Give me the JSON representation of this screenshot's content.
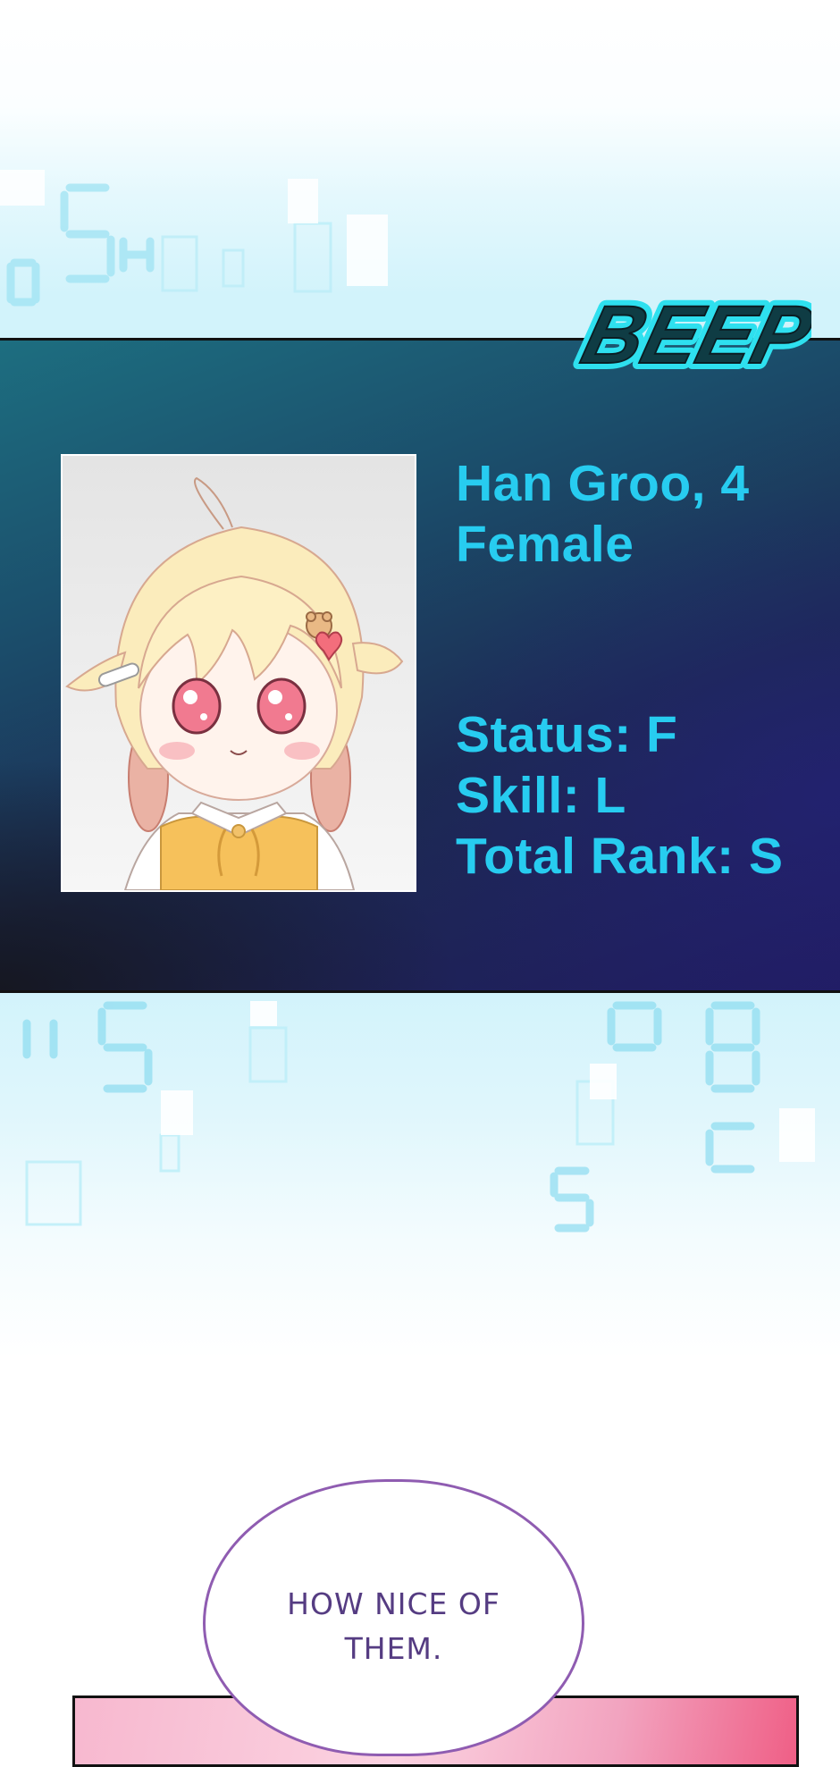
{
  "sfx": "BEEP",
  "profile": {
    "name_age": "Han Groo, 4",
    "gender": "Female",
    "status": "Status: F",
    "skill": "Skill: L",
    "total_rank": "Total Rank: S"
  },
  "speech_bubble": {
    "line1": "HOW NICE OF",
    "line2": "THEM."
  },
  "colors": {
    "info_text": "#27ccf0",
    "panel_teal": "#1d6e80",
    "panel_navy": "#201c5e",
    "sfx_cyan": "#2ee0ef",
    "bubble_border": "#8f5cb1",
    "bubble_text": "#553c82"
  }
}
